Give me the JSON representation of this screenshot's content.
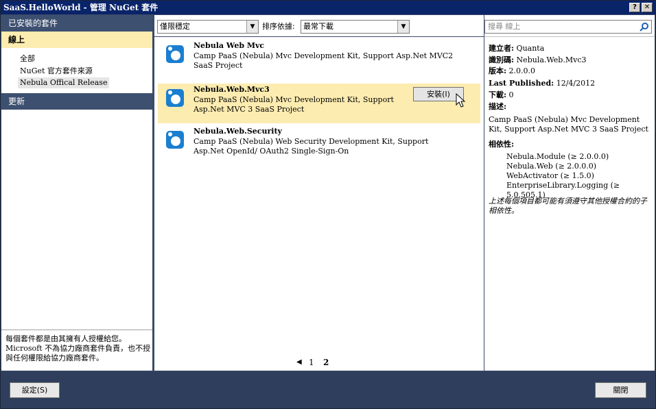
{
  "window": {
    "title": "SaaS.HelloWorld - 管理 NuGet 套件",
    "help_label": "?",
    "close_label": "✕"
  },
  "left": {
    "installed_header": "已安裝的套件",
    "online_header": "線上",
    "tree": [
      "全部",
      "NuGet 官方套件來源",
      "Nebula Offical Release"
    ],
    "updates_header": "更新",
    "notice": "每個套件都是由其擁有人授權給您。Microsoft 不為協力廠商套件負責，也不授與任何權限給協力廠商套件。"
  },
  "toolbar": {
    "filter_value": "僅限穩定",
    "sort_label": "排序依據:",
    "sort_value": "最常下載"
  },
  "packages": [
    {
      "name": "Nebula Web Mvc",
      "description": "Camp PaaS (Nebula) Mvc Development Kit, Support Asp.Net MVC2 SaaS Project"
    },
    {
      "name": "Nebula.Web.Mvc3",
      "description": "Camp PaaS (Nebula) Mvc Development Kit, Support Asp.Net MVC 3 SaaS Project"
    },
    {
      "name": "Nebula.Web.Security",
      "description": "Camp PaaS (Nebula) Web Security Development Kit, Support Asp.Net OpenId/ OAuth2 Single-Sign-On"
    }
  ],
  "install_button": "安裝(I)",
  "pager": {
    "prev": "◀",
    "pages": [
      "1",
      "2"
    ]
  },
  "search": {
    "placeholder": "搜尋 線上"
  },
  "details": {
    "author_label": "建立者:",
    "author": " Quanta",
    "id_label": "識別碼:",
    "id": " Nebula.Web.Mvc3",
    "version_label": "版本:",
    "version": " 2.0.0.0",
    "published_label": "Last Published:",
    "published": " 12/4/2012",
    "downloads_label": "下載:",
    "downloads": " 0",
    "desc_label": "描述:",
    "description": "Camp PaaS (Nebula) Mvc Development Kit, Support Asp.Net MVC 3 SaaS Project",
    "deps_label": "相依性:",
    "dependencies": [
      "Nebula.Module (≥ 2.0.0.0)",
      "Nebula.Web (≥ 2.0.0.0)",
      "WebActivator (≥ 1.5.0)",
      "EnterpriseLibrary.Logging (≥ 5.0.505.1)"
    ],
    "note": "上述每個項目都可能有須遵守其他授權合約的子相依性。"
  },
  "bottom": {
    "settings_label": "設定(S)",
    "close_label": "關閉"
  },
  "colors": {
    "title_bar": "#0a246a",
    "panel_header": "#3e5070",
    "selected": "#fcecb0",
    "bottom_bar": "#2f3e5c"
  }
}
